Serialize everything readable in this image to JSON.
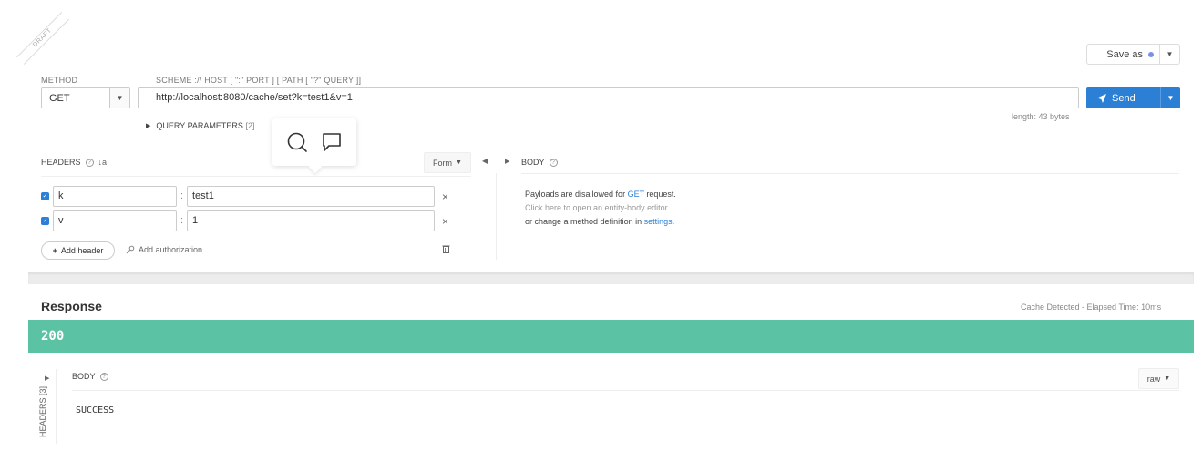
{
  "draft_label": "DRAFT",
  "save_as": {
    "label": "Save as",
    "dot_color": "#7b8fe8"
  },
  "method": {
    "label": "METHOD",
    "value": "GET"
  },
  "url": {
    "label": "SCHEME :// HOST [ \":\" PORT ] [ PATH [ \"?\" QUERY ]]",
    "value": "http://localhost:8080/cache/set?k=test1&v=1",
    "length": "length: 43 bytes"
  },
  "send": {
    "label": "Send",
    "color": "#2b7fd4"
  },
  "query_params": {
    "label": "QUERY PARAMETERS",
    "count": "[2]"
  },
  "popup": {
    "icons": [
      "search-icon",
      "comment-icon"
    ]
  },
  "headers": {
    "title": "HEADERS",
    "form_label": "Form",
    "rows": [
      {
        "key": "k",
        "value": "test1",
        "checked": true
      },
      {
        "key": "v",
        "value": "1",
        "checked": true
      }
    ],
    "add_header": "Add header",
    "add_authorization": "Add authorization"
  },
  "body": {
    "title": "BODY",
    "line1_prefix": "Payloads are disallowed for ",
    "line1_method": "GET",
    "line1_suffix": " request.",
    "line2": "Click here to open an entity-body editor",
    "line3_prefix": "or change a method definition in ",
    "line3_link": "settings",
    "line3_suffix": "."
  },
  "response": {
    "title": "Response",
    "cache_info": "Cache Detected - Elapsed Time: 10ms",
    "status_code": "200",
    "status_color": "#5cc2a4",
    "headers_tab": "HEADERS [3]",
    "body_title": "BODY",
    "format": "raw",
    "body_text": "SUCCESS"
  }
}
